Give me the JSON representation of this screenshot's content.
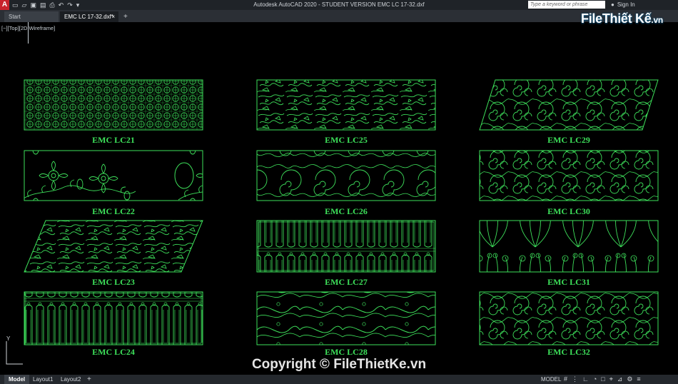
{
  "titlebar": {
    "app_icon": "A",
    "title": "Autodesk AutoCAD 2020 - STUDENT VERSION    EMC LC 17-32.dxf",
    "search_placeholder": "Type a keyword or phrase",
    "signin_label": "Sign In",
    "qat_icons": [
      "new-file-icon",
      "open-file-icon",
      "save-icon",
      "save-as-icon",
      "print-icon",
      "undo-icon",
      "redo-icon",
      "share-icon"
    ]
  },
  "tabs": [
    {
      "label": "Start"
    },
    {
      "label": "EMC LC 17-32.dxf*"
    }
  ],
  "viewport": {
    "label": "[−][Top][2D Wireframe]"
  },
  "ucs": {
    "y_label": "Y"
  },
  "panels": [
    {
      "label": "EMC LC21",
      "pattern": "lattice"
    },
    {
      "label": "EMC LC25",
      "pattern": "leaves"
    },
    {
      "label": "EMC LC29",
      "pattern": "scroll"
    },
    {
      "label": "EMC LC22",
      "pattern": "flowers"
    },
    {
      "label": "EMC LC26",
      "pattern": "arabesque"
    },
    {
      "label": "EMC LC30",
      "pattern": "scroll"
    },
    {
      "label": "EMC LC23",
      "pattern": "leaves"
    },
    {
      "label": "EMC LC27",
      "pattern": "balusters"
    },
    {
      "label": "EMC LC31",
      "pattern": "peacock"
    },
    {
      "label": "EMC LC24",
      "pattern": "balusters"
    },
    {
      "label": "EMC LC28",
      "pattern": "waves"
    },
    {
      "label": "EMC LC32",
      "pattern": "scroll"
    }
  ],
  "layout_tabs": [
    {
      "label": "Model"
    },
    {
      "label": "Layout1"
    },
    {
      "label": "Layout2"
    }
  ],
  "status": {
    "model_label": "MODEL"
  },
  "watermark": {
    "logo_main": "File",
    "logo_second": "Thiết Kế",
    "logo_tld": ".vn",
    "copyright": "Copyright © FileThietKe.vn"
  },
  "colors": {
    "linework": "#3de05a",
    "background": "#000000"
  }
}
